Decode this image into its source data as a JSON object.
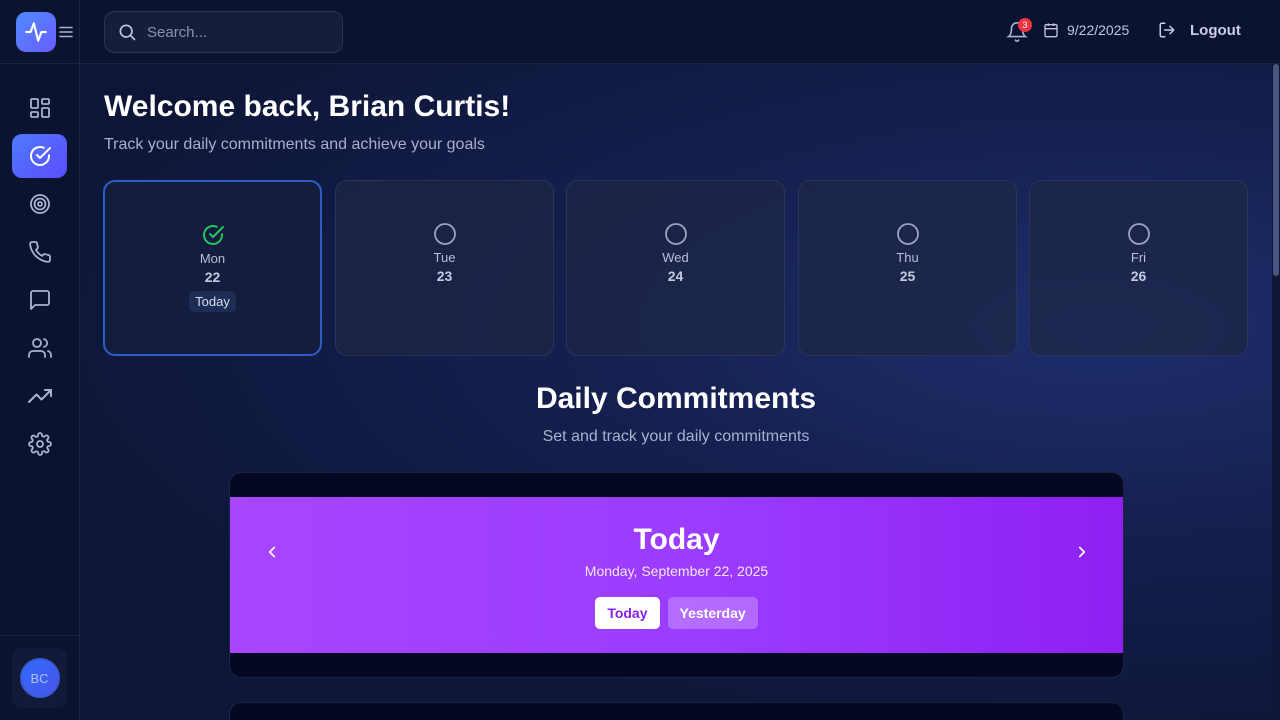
{
  "sidebar": {
    "nav": [
      {
        "icon": "dashboard-icon",
        "active": false
      },
      {
        "icon": "check-circle-icon",
        "active": true
      },
      {
        "icon": "target-icon",
        "active": false
      },
      {
        "icon": "phone-icon",
        "active": false
      },
      {
        "icon": "message-icon",
        "active": false
      },
      {
        "icon": "users-icon",
        "active": false
      },
      {
        "icon": "trending-up-icon",
        "active": false
      },
      {
        "icon": "gear-icon",
        "active": false
      }
    ],
    "avatar_initials": "BC"
  },
  "topbar": {
    "search_placeholder": "Search...",
    "notification_count": "3",
    "date": "9/22/2025",
    "logout_label": "Logout"
  },
  "welcome": {
    "title": "Welcome back, Brian Curtis!",
    "subtitle": "Track your daily commitments and achieve your goals"
  },
  "days": [
    {
      "name": "Mon",
      "num": "22",
      "today_label": "Today",
      "done": true
    },
    {
      "name": "Tue",
      "num": "23",
      "done": false
    },
    {
      "name": "Wed",
      "num": "24",
      "done": false
    },
    {
      "name": "Thu",
      "num": "25",
      "done": false
    },
    {
      "name": "Fri",
      "num": "26",
      "done": false
    }
  ],
  "commitments": {
    "title": "Daily Commitments",
    "subtitle": "Set and track your daily commitments",
    "banner_title": "Today",
    "banner_date": "Monday, September 22, 2025",
    "btn_today": "Today",
    "btn_yesterday": "Yesterday"
  },
  "colors": {
    "accent": "#4f7bff",
    "banner": "#a845ff",
    "success": "#22c55e",
    "badge": "#ef3340"
  }
}
